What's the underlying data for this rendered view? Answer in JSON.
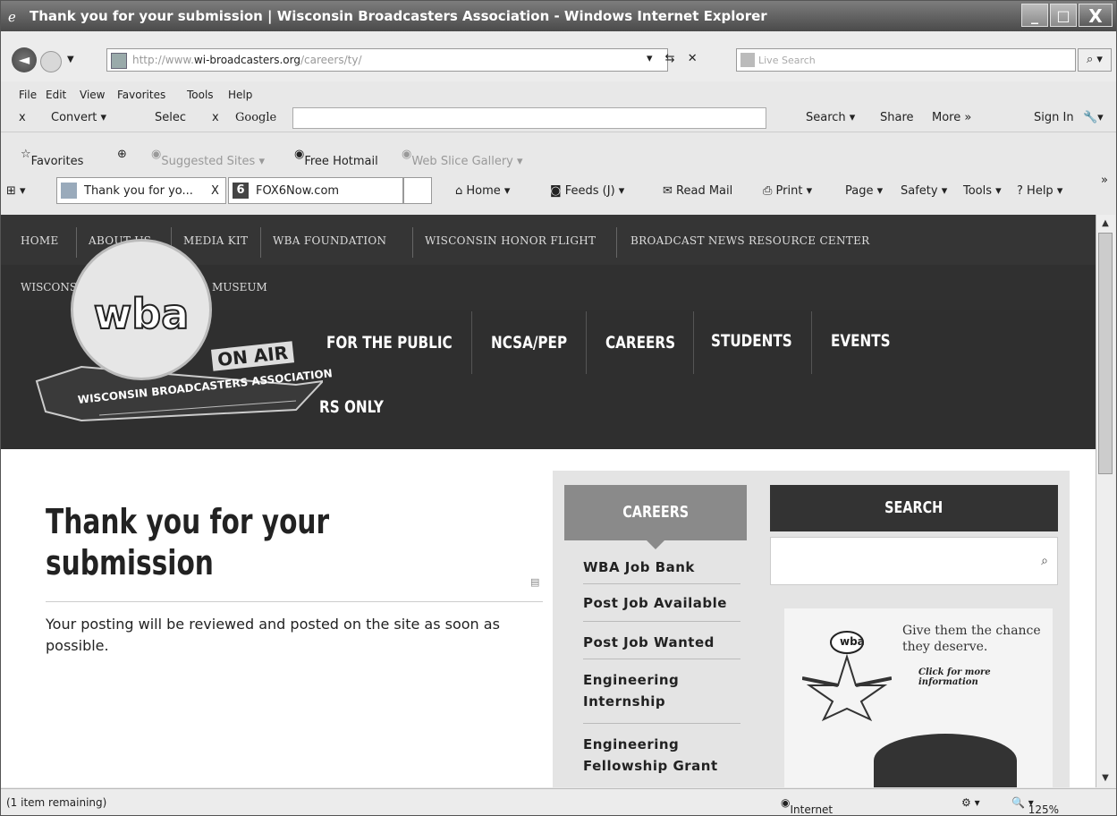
{
  "window": {
    "title": "Thank you for your submission | Wisconsin Broadcasters Association - Windows Internet Explorer",
    "min": "_",
    "max": "□",
    "close": "X"
  },
  "address": {
    "url_prefix": "http://www.",
    "url_domain": "wi-broadcasters.org",
    "url_path": "/careers/ty/",
    "search_placeholder": "Live Search",
    "back": "◄"
  },
  "menu": {
    "file": "File",
    "edit": "Edit",
    "view": "View",
    "favorites": "Favorites",
    "tools": "Tools",
    "help": "Help"
  },
  "toolbar2": {
    "close": "x",
    "convert": "Convert ▾",
    "select": "Selec",
    "google_close": "x",
    "google": "Google",
    "search": "Search ▾",
    "share": "Share",
    "more": "More »",
    "signin": "Sign In"
  },
  "favbar": {
    "favorites": "Favorites",
    "suggested": "Suggested Sites ▾",
    "hotmail": "Free Hotmail",
    "gallery": "Web Slice Gallery ▾"
  },
  "tabs": {
    "tab1": "Thank you for yo...",
    "tab1_close": "X",
    "tab2": "FOX6Now.com",
    "home": "Home",
    "feeds": "Feeds (J)",
    "readmail": "Read Mail",
    "print": "Print",
    "page": "Page ▾",
    "safety": "Safety ▾",
    "tools": "Tools ▾",
    "help": "Help ▾",
    "overflow": "»"
  },
  "site": {
    "topnav": [
      "HOME",
      "ABOUT US",
      "MEDIA KIT",
      "WBA FOUNDATION",
      "WISCONSIN HONOR FLIGHT",
      "BROADCAST NEWS RESOURCE CENTER"
    ],
    "row2": [
      "WISCONSIN",
      "MUSEUM"
    ],
    "mainnav": [
      "FOR THE PUBLIC",
      "NCSA/PEP",
      "CAREERS",
      "STUDENTS",
      "EVENTS"
    ],
    "members_only": "RS ONLY",
    "logo_text": "wba",
    "on_air": "ON AIR",
    "banner_text": "WISCONSIN BROADCASTERS ASSOCIATION"
  },
  "content": {
    "title_line1": "Thank you for your",
    "title_line2": "submission",
    "body": "Your posting will be reviewed and posted on the site as soon as possible."
  },
  "sidebar": {
    "careers_heading": "CAREERS",
    "links": [
      "WBA Job Bank",
      "Post Job Available",
      "Post Job Wanted",
      "Engineering Internship",
      "Engineering Fellowship Grant"
    ],
    "search_heading": "SEARCH",
    "ad_text": "Give them the chance they deserve.",
    "ad_cta": "Click for more information",
    "ad_logo": "wba"
  },
  "status": {
    "remaining": "(1 item remaining)",
    "zone": "Internet",
    "zoom": "125%"
  }
}
